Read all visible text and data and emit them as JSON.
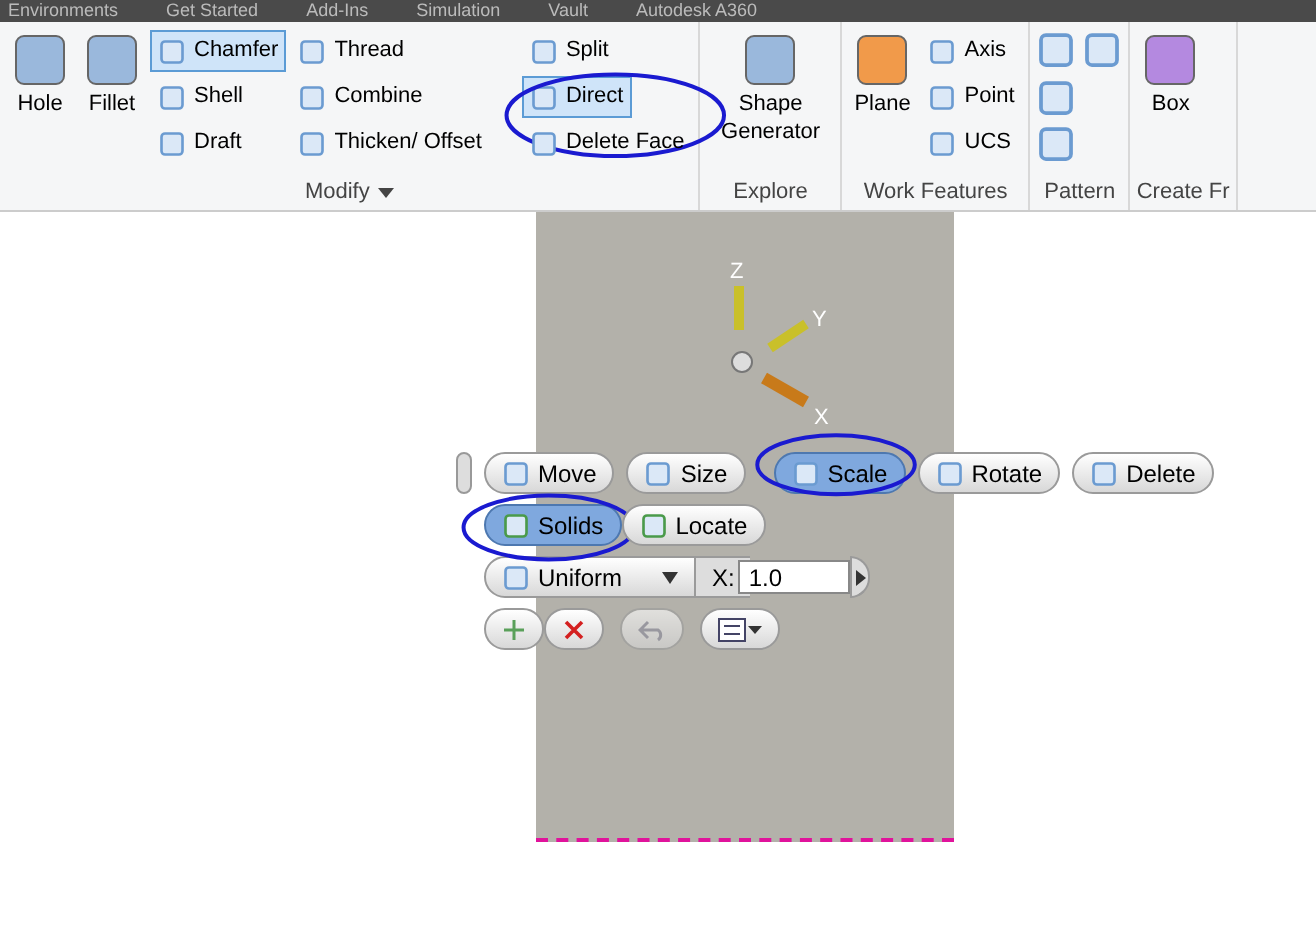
{
  "tabs": [
    {
      "label": "Environments",
      "selected": false
    },
    {
      "label": "Get Started",
      "selected": false
    },
    {
      "label": "Add-Ins",
      "selected": false
    },
    {
      "label": "Simulation",
      "selected": false
    },
    {
      "label": "Vault",
      "selected": false
    },
    {
      "label": "Autodesk A360",
      "selected": false
    }
  ],
  "ribbon": {
    "panels": [
      {
        "label": "Modify",
        "has_menu": true,
        "large": [
          {
            "label": "Hole"
          },
          {
            "label": "Fillet"
          }
        ],
        "columns": [
          [
            {
              "label": "Chamfer",
              "selected": true
            },
            {
              "label": "Shell",
              "selected": false
            },
            {
              "label": "Draft",
              "selected": false
            }
          ],
          [
            {
              "label": "Thread",
              "selected": false
            },
            {
              "label": "Combine",
              "selected": false
            },
            {
              "label": "Thicken/ Offset",
              "selected": false
            }
          ],
          [
            {
              "label": "Split",
              "selected": false
            },
            {
              "label": "Direct",
              "selected": true
            },
            {
              "label": "Delete Face",
              "selected": false
            }
          ]
        ]
      },
      {
        "label": "Explore",
        "has_menu": false,
        "large": [
          {
            "label": "Shape Generator"
          }
        ]
      },
      {
        "label": "Work Features",
        "has_menu": false,
        "large": [
          {
            "label": "Plane"
          }
        ],
        "columns": [
          [
            {
              "label": "Axis",
              "selected": false
            },
            {
              "label": "Point",
              "selected": false
            },
            {
              "label": "UCS",
              "selected": false
            }
          ]
        ]
      },
      {
        "label": "Pattern",
        "has_menu": false
      },
      {
        "label": "Create Fr",
        "has_menu": false,
        "large": [
          {
            "label": "Box"
          }
        ]
      }
    ]
  },
  "triad": {
    "axes": [
      "Z",
      "Y",
      "X"
    ]
  },
  "minitoolbar": {
    "modes": [
      {
        "label": "Move",
        "selected": false
      },
      {
        "label": "Size",
        "selected": false
      },
      {
        "label": "Scale",
        "selected": true
      },
      {
        "label": "Rotate",
        "selected": false
      },
      {
        "label": "Delete",
        "selected": false
      }
    ],
    "filters": [
      {
        "label": "Solids",
        "selected": true
      },
      {
        "label": "Locate",
        "selected": false
      }
    ],
    "scale_type": "Uniform",
    "x_label": "X:",
    "x_value": "1.0"
  }
}
